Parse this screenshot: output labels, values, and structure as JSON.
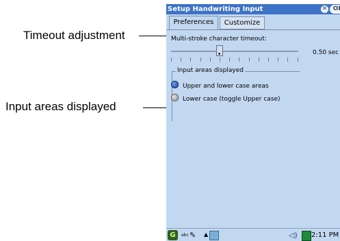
{
  "callouts": {
    "timeout_label": "Timeout adjustment",
    "input_areas_label": "Input areas displayed"
  },
  "window": {
    "title": "Setup Handwriting Input",
    "close_glyph": "✕",
    "ok_label": "OK"
  },
  "tabs": [
    {
      "label": "Preferences",
      "active": true
    },
    {
      "label": "Customize",
      "active": false
    }
  ],
  "timeout": {
    "label": "Multi-stroke character timeout:",
    "value_text": "0.50 sec",
    "level_fraction": 0.38
  },
  "input_areas": {
    "group_title": "Input areas displayed",
    "options": [
      {
        "label": "Upper and lower case areas",
        "selected": true
      },
      {
        "label": "Lower case (toggle Upper case)",
        "selected": false
      }
    ]
  },
  "taskbar": {
    "input_method": "abc",
    "time": "2:11 PM"
  },
  "colors": {
    "title_bar": "#3d72c6",
    "background": "#c2d8f1",
    "radio_on": "#1b3f99"
  }
}
